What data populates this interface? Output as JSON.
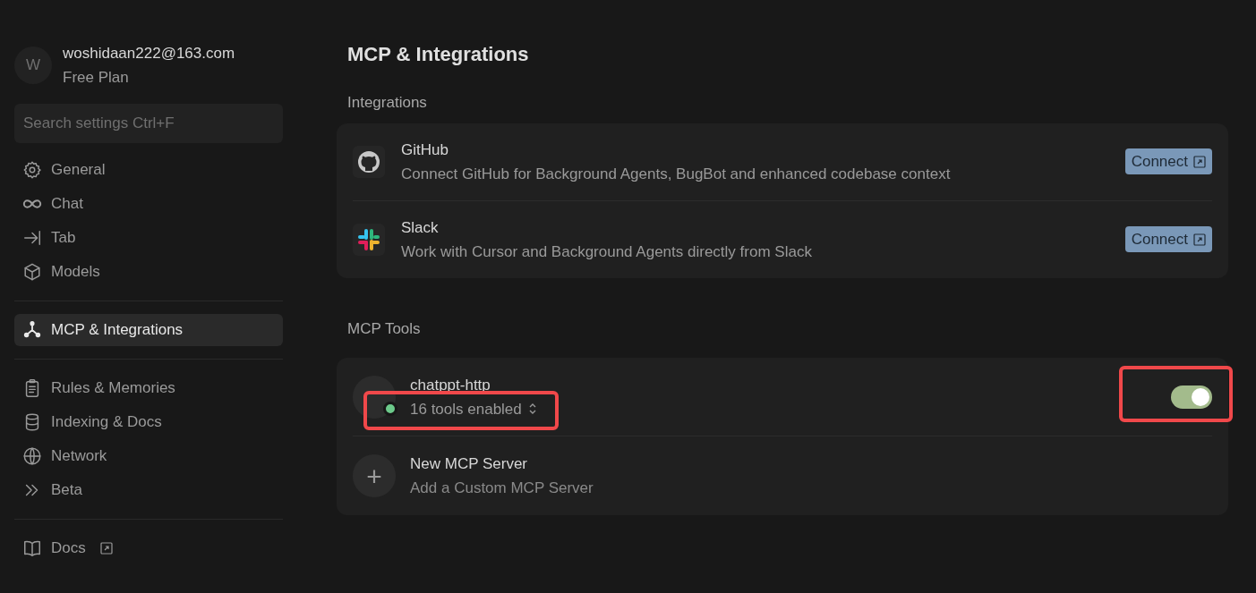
{
  "account": {
    "avatar": "W",
    "email": "woshidaan222@163.com",
    "plan": "Free Plan"
  },
  "search": {
    "placeholder": "Search settings Ctrl+F"
  },
  "sidebar": {
    "groups": [
      {
        "items": [
          {
            "label": "General",
            "selected": false
          },
          {
            "label": "Chat",
            "selected": false
          },
          {
            "label": "Tab",
            "selected": false
          },
          {
            "label": "Models",
            "selected": false
          }
        ]
      },
      {
        "items": [
          {
            "label": "MCP & Integrations",
            "selected": true
          }
        ]
      },
      {
        "items": [
          {
            "label": "Rules & Memories",
            "selected": false
          },
          {
            "label": "Indexing & Docs",
            "selected": false
          },
          {
            "label": "Network",
            "selected": false
          },
          {
            "label": "Beta",
            "selected": false
          }
        ]
      },
      {
        "items": [
          {
            "label": "Docs",
            "selected": false,
            "external": true
          }
        ]
      }
    ]
  },
  "page": {
    "title": "MCP & Integrations"
  },
  "integrations": {
    "heading": "Integrations",
    "items": [
      {
        "name": "GitHub",
        "description": "Connect GitHub for Background Agents, BugBot and enhanced codebase context",
        "button": "Connect"
      },
      {
        "name": "Slack",
        "description": "Work with Cursor and Background Agents directly from Slack",
        "button": "Connect"
      }
    ]
  },
  "mcp_tools": {
    "heading": "MCP Tools",
    "servers": [
      {
        "name": "chatppt-http",
        "status": "16 tools enabled",
        "color": "#6cc98a",
        "on": true,
        "highlighted": true
      }
    ],
    "add": {
      "icon": "+",
      "title": "New MCP Server",
      "subtitle": "Add a Custom MCP Server"
    }
  }
}
